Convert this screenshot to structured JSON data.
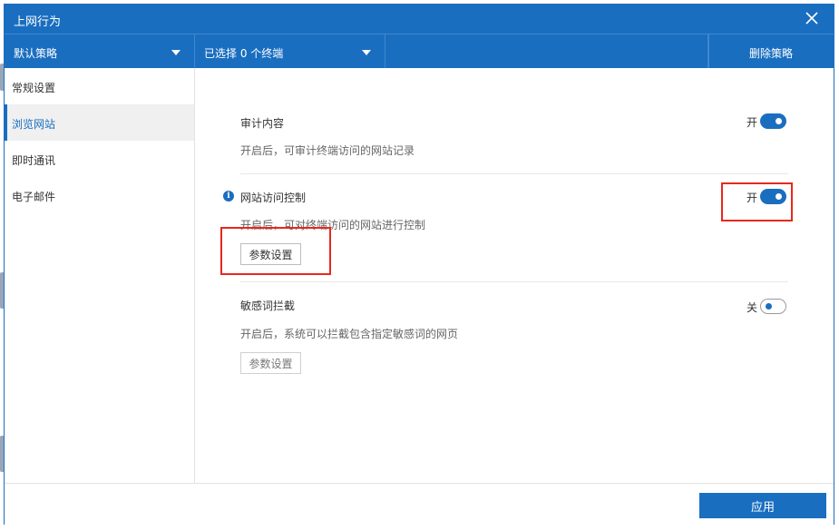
{
  "window": {
    "title": "上网行为"
  },
  "toolbar": {
    "policy_select": "默认策略",
    "terminal_select": "已选择 0 个终端",
    "delete_policy": "删除策略"
  },
  "sidebar": {
    "items": [
      {
        "label": "常规设置",
        "active": false
      },
      {
        "label": "浏览网站",
        "active": true
      },
      {
        "label": "即时通讯",
        "active": false
      },
      {
        "label": "电子邮件",
        "active": false
      }
    ]
  },
  "sections": [
    {
      "title": "审计内容",
      "description": "开启后，可审计终端访问的网站记录",
      "toggle_state": "开",
      "enabled": true
    },
    {
      "title": "网站访问控制",
      "description": "开启后，可对终端访问的网站进行控制",
      "toggle_state": "开",
      "enabled": true,
      "button_label": "参数设置"
    },
    {
      "title": "敏感词拦截",
      "description": "开启后，系统可以拦截包含指定敏感词的网页",
      "toggle_state": "关",
      "enabled": false,
      "button_label": "参数设置"
    }
  ],
  "footer": {
    "apply_label": "应用"
  },
  "colors": {
    "primary": "#1a6ec0",
    "highlight": "#e8281e"
  },
  "icons": {
    "close": "close-icon",
    "dropdown": "chevron-down-icon",
    "info": "info-icon"
  }
}
